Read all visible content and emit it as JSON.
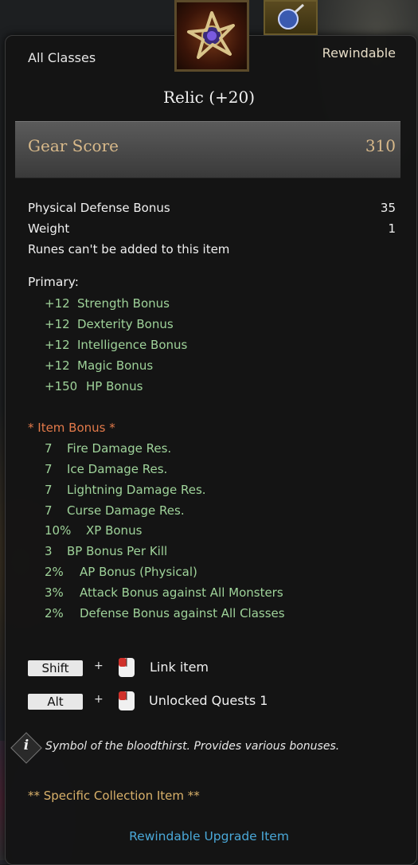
{
  "tooltip": {
    "class_requirement": "All Classes",
    "rewindable_tag": "Rewindable",
    "item_name": "Relic (+20)",
    "gear_score_label": "Gear Score",
    "gear_score_value": "310",
    "stats": [
      {
        "label": "Physical Defense Bonus",
        "value": "35"
      },
      {
        "label": "Weight",
        "value": "1"
      }
    ],
    "rune_note": "Runes can't be added to this item",
    "primary": {
      "heading": "Primary:",
      "lines": [
        {
          "value": "+12",
          "label": "Strength Bonus"
        },
        {
          "value": "+12",
          "label": "Dexterity Bonus"
        },
        {
          "value": "+12",
          "label": "Intelligence Bonus"
        },
        {
          "value": "+12",
          "label": "Magic Bonus"
        },
        {
          "value": "+150",
          "label": "HP Bonus"
        }
      ]
    },
    "item_bonus": {
      "heading": "* Item Bonus *",
      "lines": [
        {
          "value": "7",
          "label": "Fire Damage Res."
        },
        {
          "value": "7",
          "label": "Ice Damage Res."
        },
        {
          "value": "7",
          "label": "Lightning Damage Res."
        },
        {
          "value": "7",
          "label": "Curse Damage Res."
        },
        {
          "value": "10%",
          "label": "XP Bonus"
        },
        {
          "value": "3",
          "label": "BP Bonus Per Kill"
        },
        {
          "value": "2%",
          "label": "AP Bonus (Physical)"
        },
        {
          "value": "3%",
          "label": "Attack Bonus against All Monsters"
        },
        {
          "value": "2%",
          "label": "Defense Bonus against All Classes"
        }
      ]
    },
    "shortcuts": [
      {
        "key": "Shift",
        "plus": "+",
        "action": "Link item"
      },
      {
        "key": "Alt",
        "plus": "+",
        "action": "Unlocked Quests 1"
      }
    ],
    "description": "Symbol of the bloodthirst. Provides various bonuses.",
    "collection_note": "** Specific Collection Item **",
    "upgrade_link": "Rewindable Upgrade Item",
    "colors": {
      "bonus_green": "#9fd39a",
      "item_bonus_heading": "#e37a4a",
      "gear_score_gold": "#d8b98a",
      "collection_gold": "#d9b16a",
      "link_blue": "#4aa8d8"
    }
  }
}
